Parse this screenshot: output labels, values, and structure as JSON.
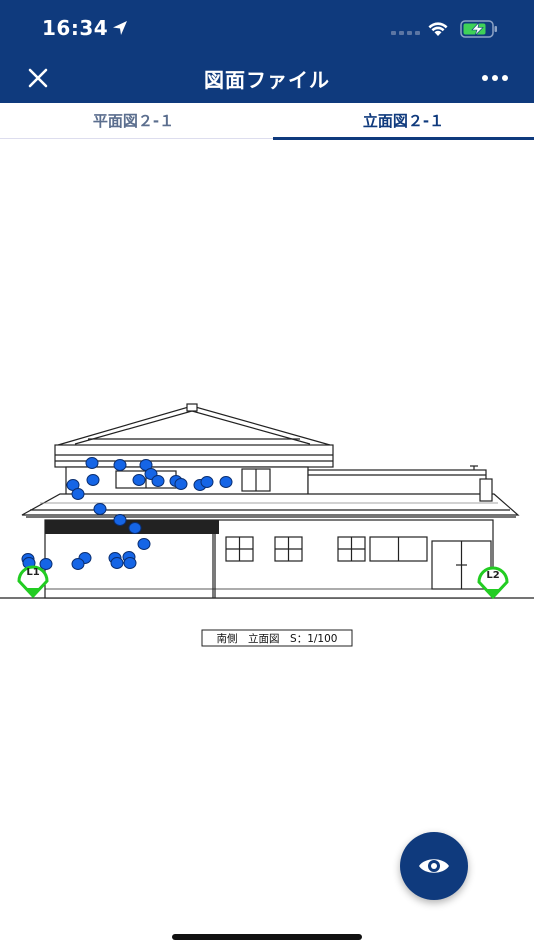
{
  "status_bar": {
    "time": "16:34"
  },
  "header": {
    "title": "図面ファイル"
  },
  "tabs": [
    {
      "label": "平面図２-１",
      "active": false
    },
    {
      "label": "立面図２-１",
      "active": true
    }
  ],
  "drawing": {
    "caption": "南側　立面図　S：1/100",
    "markers": [
      {
        "label": "L1",
        "color": "#22cc22"
      },
      {
        "label": "L2",
        "color": "#22cc22"
      }
    ],
    "point_color": "#1565e6"
  },
  "fab": {
    "icon": "eye-icon"
  },
  "colors": {
    "primary": "#0f3a7d"
  }
}
